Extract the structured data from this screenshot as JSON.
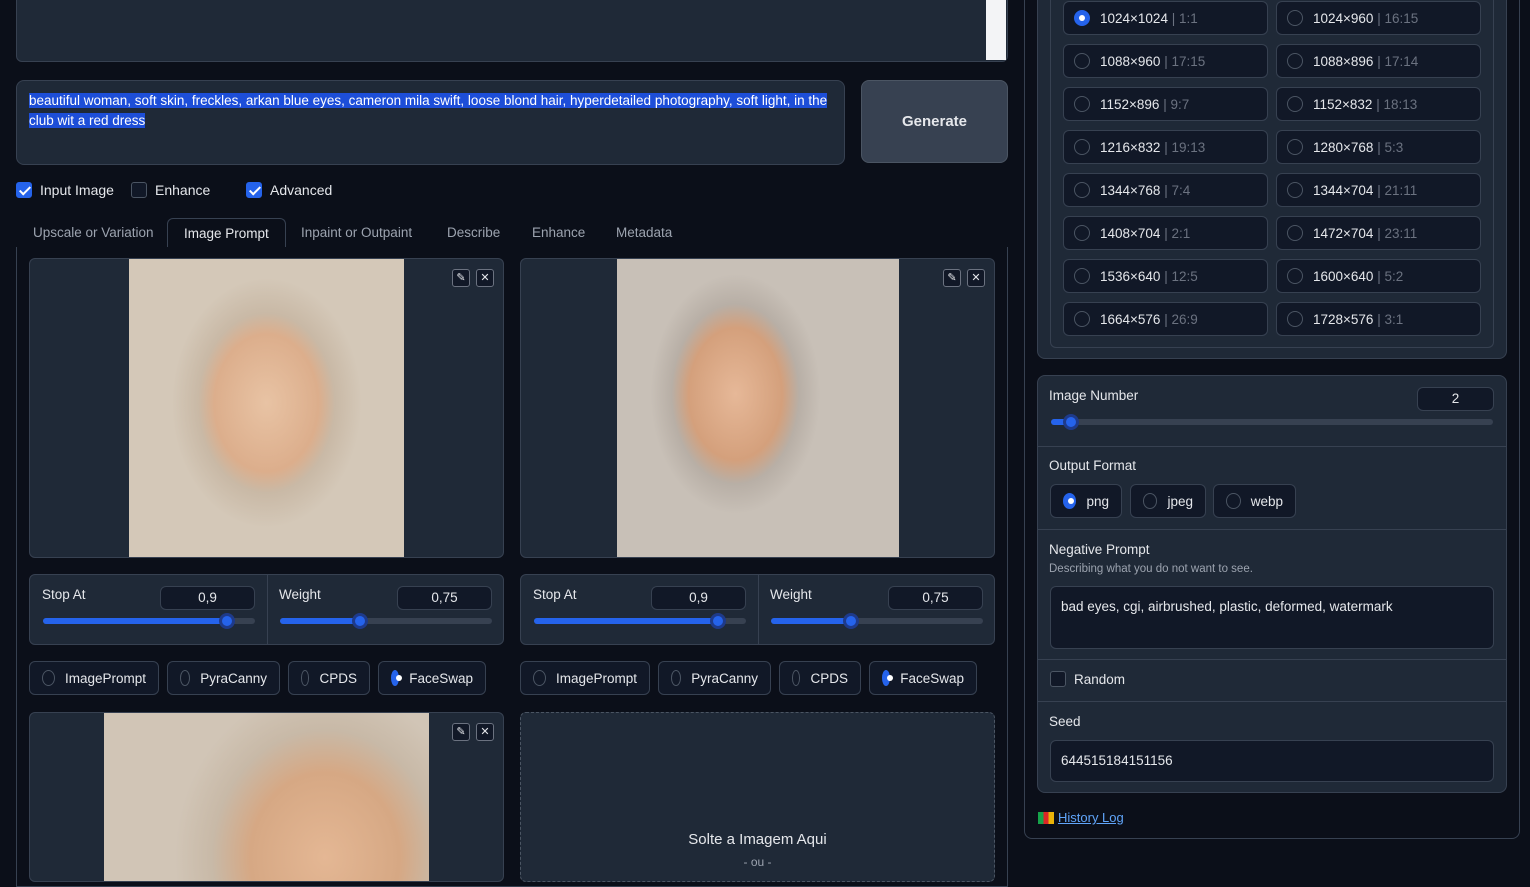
{
  "prompt": {
    "text": "beautiful woman, soft skin, freckles, arkan blue eyes, cameron mila swift,  loose blond hair, hyperdetailed photography, soft light, in the club wit a red dress"
  },
  "generate_label": "Generate",
  "options": {
    "input_image": "Input Image",
    "enhance": "Enhance",
    "advanced": "Advanced"
  },
  "tabs": [
    "Upscale or Variation",
    "Image Prompt",
    "Inpaint or Outpaint",
    "Describe",
    "Enhance",
    "Metadata"
  ],
  "image_panels": [
    {
      "stop_label": "Stop At",
      "stop_value": "0,9",
      "stop_fraction": 0.9,
      "weight_label": "Weight",
      "weight_value": "0,75",
      "weight_fraction": 0.375,
      "types": [
        "ImagePrompt",
        "PyraCanny",
        "CPDS",
        "FaceSwap"
      ],
      "selected": "FaceSwap"
    },
    {
      "stop_label": "Stop At",
      "stop_value": "0,9",
      "stop_fraction": 0.9,
      "weight_label": "Weight",
      "weight_value": "0,75",
      "weight_fraction": 0.375,
      "types": [
        "ImagePrompt",
        "PyraCanny",
        "CPDS",
        "FaceSwap"
      ],
      "selected": "FaceSwap"
    }
  ],
  "drop": {
    "label": "Solte a Imagem Aqui",
    "or": "- ou -"
  },
  "aspect_ratios": [
    {
      "res": "1024×1024",
      "ratio": "1:1",
      "selected": true
    },
    {
      "res": "1024×960",
      "ratio": "16:15"
    },
    {
      "res": "1088×960",
      "ratio": "17:15"
    },
    {
      "res": "1088×896",
      "ratio": "17:14"
    },
    {
      "res": "1152×896",
      "ratio": "9:7"
    },
    {
      "res": "1152×832",
      "ratio": "18:13"
    },
    {
      "res": "1216×832",
      "ratio": "19:13"
    },
    {
      "res": "1280×768",
      "ratio": "5:3"
    },
    {
      "res": "1344×768",
      "ratio": "7:4"
    },
    {
      "res": "1344×704",
      "ratio": "21:11"
    },
    {
      "res": "1408×704",
      "ratio": "2:1"
    },
    {
      "res": "1472×704",
      "ratio": "23:11"
    },
    {
      "res": "1536×640",
      "ratio": "12:5"
    },
    {
      "res": "1600×640",
      "ratio": "5:2"
    },
    {
      "res": "1664×576",
      "ratio": "26:9"
    },
    {
      "res": "1728×576",
      "ratio": "3:1"
    }
  ],
  "image_number": {
    "label": "Image Number",
    "value": "2",
    "fraction": 0.05
  },
  "output_format": {
    "label": "Output Format",
    "options": [
      "png",
      "jpeg",
      "webp"
    ],
    "selected": "png"
  },
  "negative": {
    "label": "Negative Prompt",
    "hint": "Describing what you do not want to see.",
    "value": "bad eyes, cgi, airbrushed, plastic, deformed, watermark"
  },
  "random_label": "Random",
  "seed": {
    "label": "Seed",
    "value": "644515184151156"
  },
  "history_label": "History Log",
  "colors": {
    "accent": "#2563eb",
    "bg": "#0b0f19",
    "panel": "#1f2937"
  }
}
